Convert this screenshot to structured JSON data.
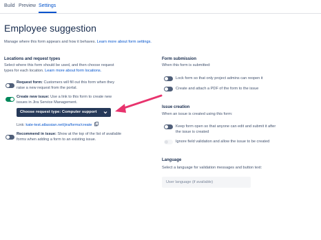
{
  "tabs": [
    {
      "label": "Build"
    },
    {
      "label": "Preview"
    },
    {
      "label": "Settings",
      "active": true
    }
  ],
  "page": {
    "title": "Employee suggestion",
    "description": "Manage where this form appears and how it behaves.",
    "description_link": "Learn more about form settings."
  },
  "locations": {
    "heading": "Locations and request types",
    "intro_line1": "Select where this form should be used, and then choose request",
    "intro_line2": "types for each location.",
    "intro_link": "Learn more about form locations.",
    "request_form": {
      "label": "Request form:",
      "text_line1": "Customers will fill out this form when they",
      "text_line2": "raise a new request from the portal.",
      "enabled": false
    },
    "create_issue": {
      "label": "Create new issue:",
      "text_line1": "Use a link to this form to create new",
      "text_line2": "issues in Jira Service Management.",
      "enabled": true,
      "dropdown_label": "Choose request type: Computer support",
      "link_label": "Link:",
      "link_url": "kate-test.atlassian.net/jira/forms/create"
    },
    "recommend_issue": {
      "label": "Recommend in issue:",
      "text_line1": "Show at the top of the list of available",
      "text_line2": "forms when adding a form to an existing issue.",
      "enabled": false
    }
  },
  "submission": {
    "heading": "Form submission",
    "intro": "When this form is submitted:",
    "options": [
      {
        "label": "Lock form so that only project admins can reopen it",
        "enabled": false
      },
      {
        "label": "Create and attach a PDF of the form to the issue",
        "enabled": false
      }
    ]
  },
  "issue_creation": {
    "heading": "Issue creation",
    "intro": "When an issue is created using this form:",
    "keep_open_line1": "Keep form open so that anyone can edit and submit it after",
    "keep_open_line2": "the issue is created",
    "keep_open_enabled": false,
    "ignore_validation": "Ignore field validation and allow the issue to be created",
    "ignore_validation_disabled": true
  },
  "language": {
    "heading": "Language",
    "intro": "Select a language for validation messages and button text:",
    "selected": "User language (if available)"
  },
  "colors": {
    "accent": "#0052cc",
    "toggle_on": "#00875a",
    "toggle_off": "#505f79",
    "dropdown_bg": "#253858",
    "annotation_arrow": "#e8336d"
  }
}
